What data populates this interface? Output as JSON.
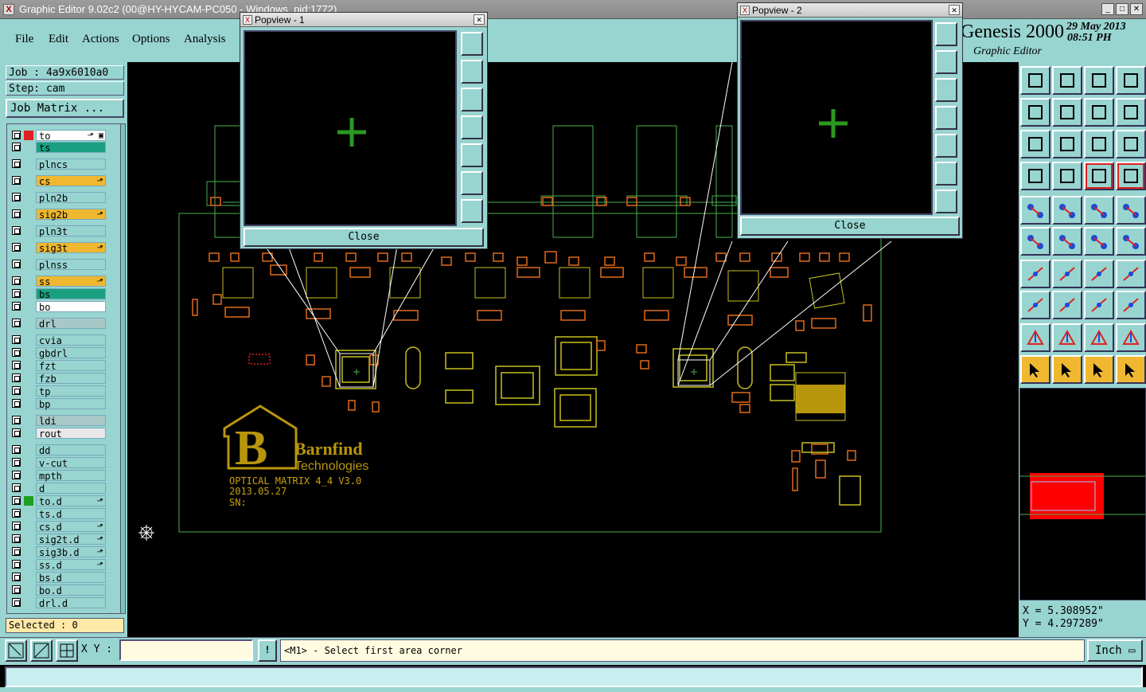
{
  "window": {
    "title": "Graphic Editor 9.02c2 (00@HY-HYCAM-PC050 - Windows_pid:1772)"
  },
  "menu": {
    "file": "File",
    "edit": "Edit",
    "actions": "Actions",
    "options": "Options",
    "analysis": "Analysis"
  },
  "branding": {
    "product": "Genesis 2000",
    "date": "29 May 2013",
    "time": "08:51 PH",
    "subtitle": "Graphic Editor"
  },
  "job": {
    "job_line": "Job : 4a9x6010a0",
    "step_line": "Step: cam",
    "matrix_button": "Job Matrix ..."
  },
  "layers": [
    {
      "name": "to",
      "color": "#ffffff",
      "swatch": "#e02020",
      "mark": "⬏ ▣"
    },
    {
      "name": "ts",
      "color": "#1aa080",
      "swatch": "",
      "mark": ""
    },
    {
      "name": "plncs",
      "color": "#98d4d0",
      "swatch": "",
      "mark": ""
    },
    {
      "name": "cs",
      "color": "#f0b830",
      "swatch": "",
      "mark": "⬏"
    },
    {
      "name": "pln2b",
      "color": "#98d4d0",
      "swatch": "",
      "mark": ""
    },
    {
      "name": "sig2b",
      "color": "#f0b830",
      "swatch": "",
      "mark": "⬏"
    },
    {
      "name": "pln3t",
      "color": "#98d4d0",
      "swatch": "",
      "mark": ""
    },
    {
      "name": "sig3t",
      "color": "#f0b830",
      "swatch": "",
      "mark": "⬏"
    },
    {
      "name": "plnss",
      "color": "#98d4d0",
      "swatch": "",
      "mark": ""
    },
    {
      "name": "ss",
      "color": "#f0b830",
      "swatch": "",
      "mark": "⬏"
    },
    {
      "name": "bs",
      "color": "#1aa080",
      "swatch": "",
      "mark": ""
    },
    {
      "name": "bo",
      "color": "#ffffff",
      "swatch": "",
      "mark": ""
    },
    {
      "name": "drl",
      "color": "#a8c8c8",
      "swatch": "",
      "mark": ""
    },
    {
      "name": "cvia",
      "color": "#98d4d0",
      "swatch": "",
      "mark": ""
    },
    {
      "name": "gbdrl",
      "color": "#98d4d0",
      "swatch": "",
      "mark": ""
    },
    {
      "name": "fzt",
      "color": "#98d4d0",
      "swatch": "",
      "mark": ""
    },
    {
      "name": "fzb",
      "color": "#98d4d0",
      "swatch": "",
      "mark": ""
    },
    {
      "name": "tp",
      "color": "#98d4d0",
      "swatch": "",
      "mark": ""
    },
    {
      "name": "bp",
      "color": "#98d4d0",
      "swatch": "",
      "mark": ""
    },
    {
      "name": "ldi",
      "color": "#a8c8c8",
      "swatch": "",
      "mark": ""
    },
    {
      "name": "rout",
      "color": "#e8e8e8",
      "swatch": "",
      "mark": ""
    },
    {
      "name": "dd",
      "color": "#98d4d0",
      "swatch": "",
      "mark": ""
    },
    {
      "name": "v-cut",
      "color": "#98d4d0",
      "swatch": "",
      "mark": ""
    },
    {
      "name": "mpth",
      "color": "#98d4d0",
      "swatch": "",
      "mark": ""
    },
    {
      "name": "d",
      "color": "#98d4d0",
      "swatch": "",
      "mark": ""
    },
    {
      "name": "to.d",
      "color": "#98d4d0",
      "swatch": "#20a020",
      "mark": "⬏"
    },
    {
      "name": "ts.d",
      "color": "#98d4d0",
      "swatch": "",
      "mark": ""
    },
    {
      "name": "cs.d",
      "color": "#98d4d0",
      "swatch": "",
      "mark": "⬏"
    },
    {
      "name": "sig2t.d",
      "color": "#98d4d0",
      "swatch": "",
      "mark": "⬏"
    },
    {
      "name": "sig3b.d",
      "color": "#98d4d0",
      "swatch": "",
      "mark": "⬏"
    },
    {
      "name": "ss.d",
      "color": "#98d4d0",
      "swatch": "",
      "mark": "⬏"
    },
    {
      "name": "bs.d",
      "color": "#98d4d0",
      "swatch": "",
      "mark": ""
    },
    {
      "name": "bo.d",
      "color": "#98d4d0",
      "swatch": "",
      "mark": ""
    },
    {
      "name": "drl.d",
      "color": "#98d4d0",
      "swatch": "",
      "mark": ""
    }
  ],
  "selected": "Selected : 0",
  "board": {
    "logo_letter": "B",
    "logo_name": "Barnfind",
    "logo_sub": "Technologies",
    "text_line1": "OPTICAL MATRIX 4_4 V3.0",
    "text_line2": "2013.05.27",
    "text_line3": "SN:"
  },
  "popview1": {
    "title": "Popview - 1",
    "close_label": "Close",
    "close_x": "✕"
  },
  "popview2": {
    "title": "Popview - 2",
    "close_label": "Close",
    "close_x": "✕"
  },
  "coords": {
    "x": "X = 5.308952\"",
    "y": "Y = 4.297289\""
  },
  "bottom": {
    "xy_label": "X Y :",
    "xy_value": "",
    "excl": "!",
    "prompt": "<M1> - Select first area corner",
    "unit": "Inch ▭"
  },
  "colors": {
    "panel": "#98d4d0",
    "board_outline": "#4caf50",
    "pad_orange": "#e06a1a",
    "pad_yellow": "#c8c020",
    "highlight_red": "#ff0000",
    "logo_gold": "#b8960c"
  }
}
